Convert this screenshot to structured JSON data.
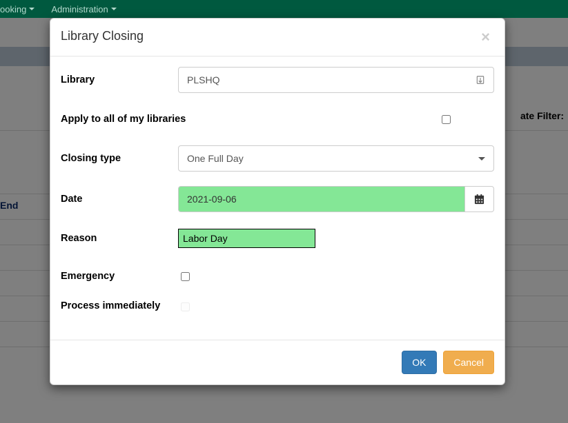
{
  "nav": {
    "booking": "ooking",
    "administration": "Administration"
  },
  "background": {
    "end_label": "End",
    "filter_label": "ate Filter:"
  },
  "modal": {
    "title": "Library Closing",
    "labels": {
      "library": "Library",
      "apply_all": "Apply to all of my libraries",
      "closing_type": "Closing type",
      "date": "Date",
      "reason": "Reason",
      "emergency": "Emergency",
      "process_immediately": "Process immediately"
    },
    "values": {
      "library": "PLSHQ",
      "closing_type": "One Full Day",
      "date": "2021-09-06",
      "reason": "Labor Day",
      "apply_all_checked": false,
      "emergency_checked": false,
      "process_immediately_checked": false
    },
    "buttons": {
      "ok": "OK",
      "cancel": "Cancel"
    }
  }
}
